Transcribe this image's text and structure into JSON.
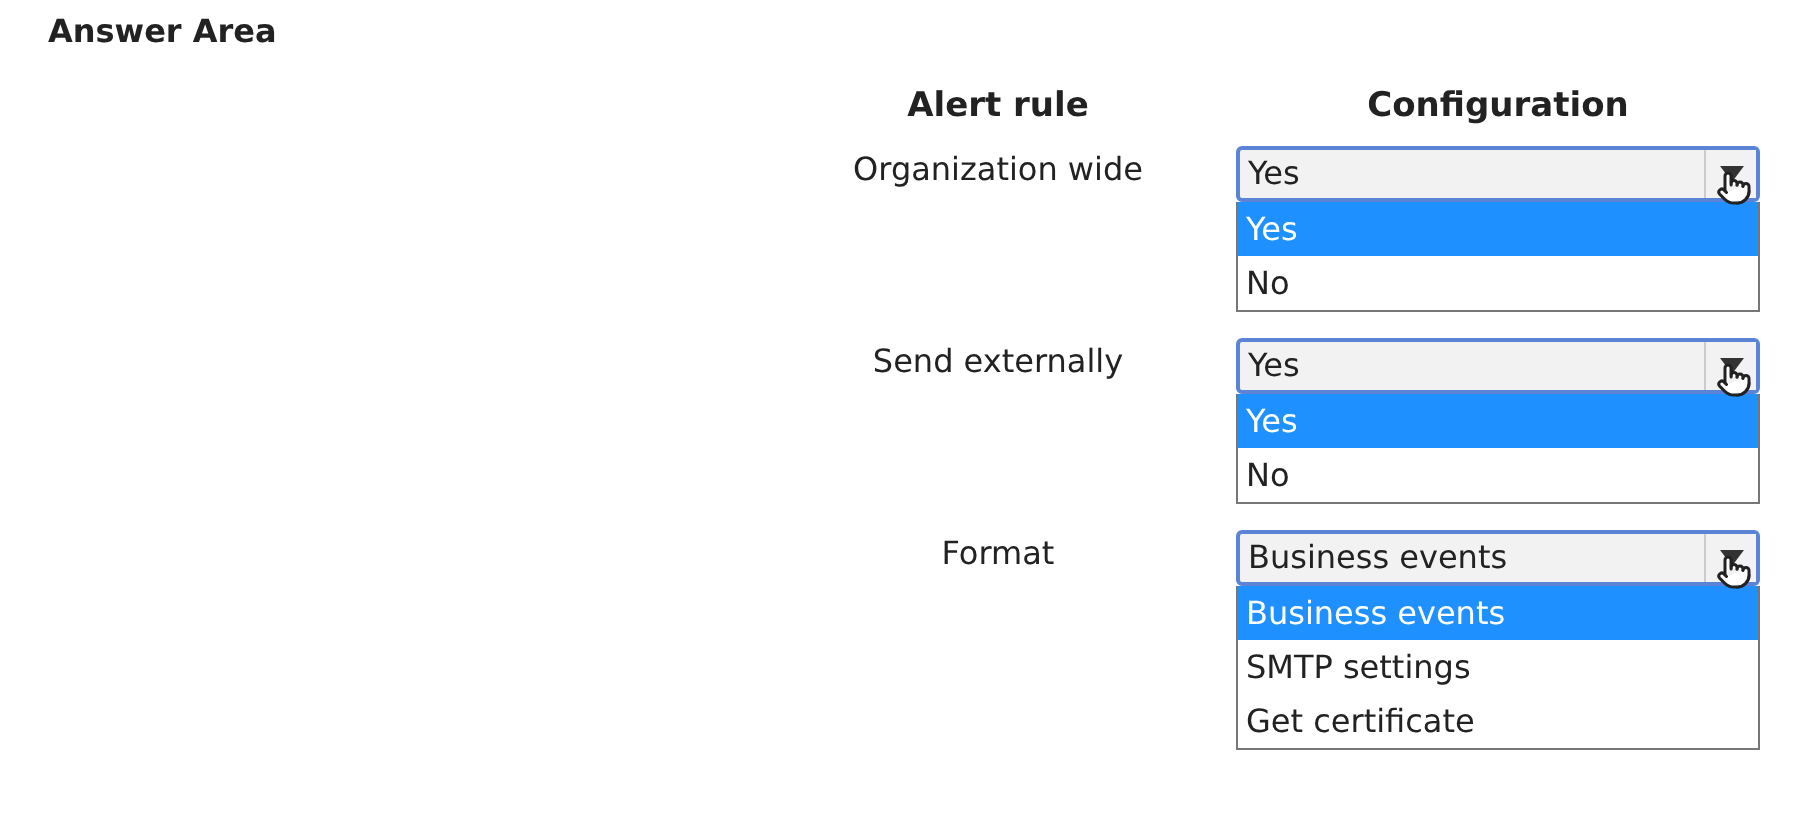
{
  "title": "Answer Area",
  "columns": [
    "Alert rule",
    "Configuration"
  ],
  "rows": [
    {
      "label": "Organization wide",
      "value": "Yes",
      "options": [
        {
          "label": "Yes",
          "selected": true
        },
        {
          "label": "No",
          "selected": false
        }
      ]
    },
    {
      "label": "Send externally",
      "value": "Yes",
      "options": [
        {
          "label": "Yes",
          "selected": true
        },
        {
          "label": "No",
          "selected": false
        }
      ]
    },
    {
      "label": "Format",
      "value": "Business events",
      "options": [
        {
          "label": "Business events",
          "selected": true
        },
        {
          "label": "SMTP settings",
          "selected": false
        },
        {
          "label": "Get certificate",
          "selected": false
        }
      ]
    }
  ]
}
